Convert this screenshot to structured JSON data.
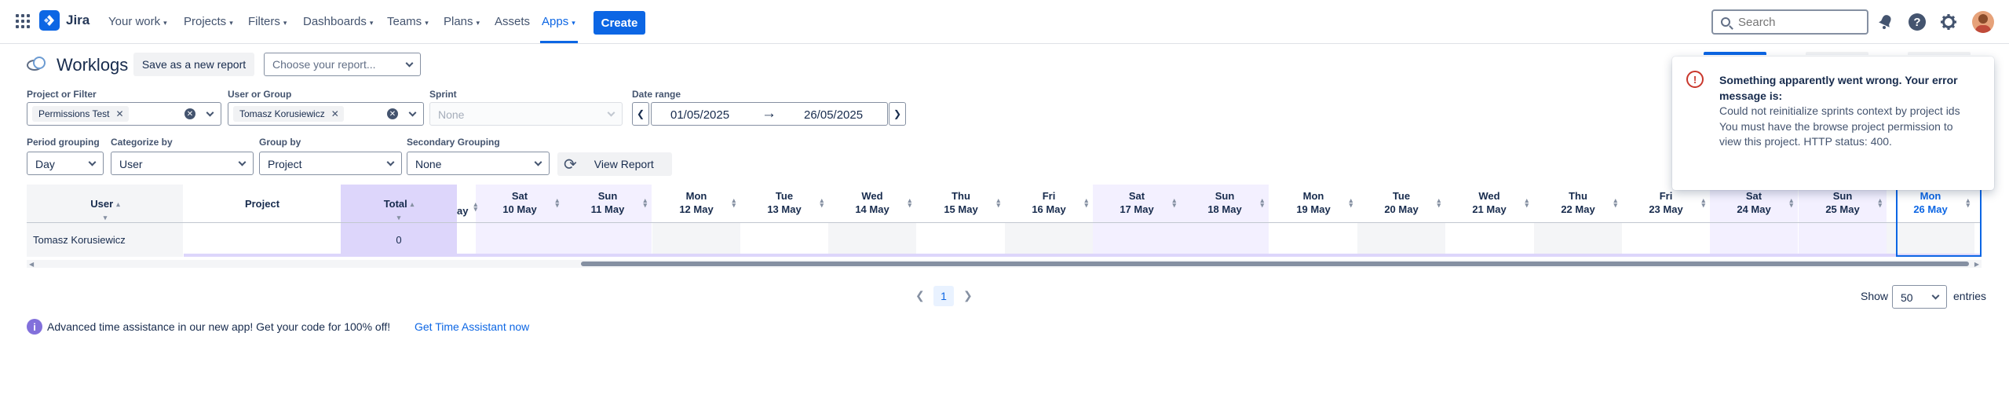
{
  "nav": {
    "brand": "Jira",
    "items": [
      "Your work",
      "Projects",
      "Filters",
      "Dashboards",
      "Teams",
      "Plans",
      "Assets",
      "Apps"
    ],
    "active": "Apps",
    "create_label": "Create",
    "search_placeholder": "Search",
    "accent_color": "#0c66e4"
  },
  "header": {
    "title": "Worklogs",
    "save_label": "Save as a new report",
    "report_placeholder": "Choose your report..."
  },
  "filters": {
    "project_label": "Project or Filter",
    "project_chip": "Permissions Test",
    "user_label": "User or Group",
    "user_chip": "Tomasz Korusiewicz",
    "sprint_label": "Sprint",
    "sprint_placeholder": "None",
    "date_label": "Date range",
    "date_from": "01/05/2025",
    "date_to": "26/05/2025",
    "period_label": "Period grouping",
    "period_value": "Day",
    "categorize_label": "Categorize by",
    "categorize_value": "User",
    "group_label": "Group by",
    "group_value": "Project",
    "secondary_label": "Secondary Grouping",
    "secondary_value": "None",
    "view_label": "View Report"
  },
  "table": {
    "headers": {
      "user": "User",
      "project": "Project",
      "total": "Total"
    },
    "days": [
      {
        "dow": "Sat",
        "date": "10 May",
        "weekend": true
      },
      {
        "dow": "Sun",
        "date": "11 May",
        "weekend": true
      },
      {
        "dow": "Mon",
        "date": "12 May",
        "weekend": false
      },
      {
        "dow": "Tue",
        "date": "13 May",
        "weekend": false
      },
      {
        "dow": "Wed",
        "date": "14 May",
        "weekend": false
      },
      {
        "dow": "Thu",
        "date": "15 May",
        "weekend": false
      },
      {
        "dow": "Fri",
        "date": "16 May",
        "weekend": false
      },
      {
        "dow": "Sat",
        "date": "17 May",
        "weekend": true
      },
      {
        "dow": "Sun",
        "date": "18 May",
        "weekend": true
      },
      {
        "dow": "Mon",
        "date": "19 May",
        "weekend": false
      },
      {
        "dow": "Tue",
        "date": "20 May",
        "weekend": false
      },
      {
        "dow": "Wed",
        "date": "21 May",
        "weekend": false
      },
      {
        "dow": "Thu",
        "date": "22 May",
        "weekend": false
      },
      {
        "dow": "Fri",
        "date": "23 May",
        "weekend": false
      },
      {
        "dow": "Sat",
        "date": "24 May",
        "weekend": true
      },
      {
        "dow": "Sun",
        "date": "25 May",
        "weekend": true
      },
      {
        "dow": "Mon",
        "date": "26 May",
        "weekend": false,
        "today": true
      }
    ],
    "rows": [
      {
        "user": "Tomasz Korusiewicz",
        "project": "",
        "total": "0"
      }
    ]
  },
  "pagination": {
    "current": "1",
    "show_label": "Show",
    "page_size": "50",
    "entries_label": "entries"
  },
  "promo": {
    "text": "Advanced time assistance in our new app! Get your code for 100% off!",
    "link": "Get Time Assistant now"
  },
  "flag": {
    "title": "Something apparently went wrong. Your error message is:",
    "body": "Could not reinitialize sprints context by project ids You must have the browse project permission to view this project. HTTP status: 400.",
    "color": "#c9372c"
  }
}
